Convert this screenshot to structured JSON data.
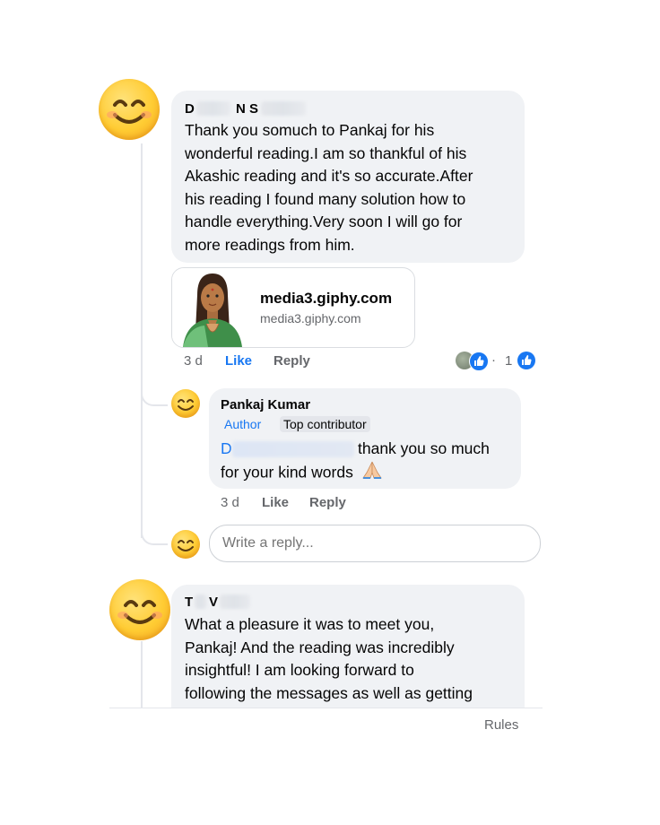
{
  "comment1": {
    "author_visible_1": "D",
    "author_visible_2": "N S",
    "text_lines": [
      "Thank you somuch to Pankaj for his",
      "wonderful reading.I am so thankful of his",
      "Akashic reading and it's so accurate.After",
      "his reading I found many solution  how to",
      "handle everything.Very soon I will go for",
      "more readings from him."
    ],
    "link_preview": {
      "title": "media3.giphy.com",
      "domain": "media3.giphy.com"
    },
    "time": "3 d",
    "like_label": "Like",
    "reply_label": "Reply",
    "reaction_count": "1"
  },
  "reply1": {
    "author": "Pankaj Kumar",
    "badge_author": "Author",
    "badge_contributor": "Top contributor",
    "mention_visible": "D",
    "text_line1_end": "thank you so much",
    "text_line2": "for your kind words",
    "time": "3 d",
    "like_label": "Like",
    "reply_label": "Reply"
  },
  "reply_box": {
    "placeholder": "Write a reply..."
  },
  "comment2": {
    "author_visible_1": "T",
    "author_visible_2": "V",
    "text_lines": [
      "What a pleasure it was to meet you,",
      "Pankaj!  And the reading was incredibly",
      "insightful!  I am looking forward to",
      "following the messages as well as getting"
    ]
  },
  "footer": {
    "rules_label": "Rules"
  },
  "colors": {
    "bubble": "#f0f2f5",
    "link_blue": "#1877f2",
    "meta_gray": "#65676b"
  },
  "icons": [
    "smiley-emoji-avatar",
    "like-icon",
    "praying-hands-icon",
    "giphy-avatar"
  ]
}
